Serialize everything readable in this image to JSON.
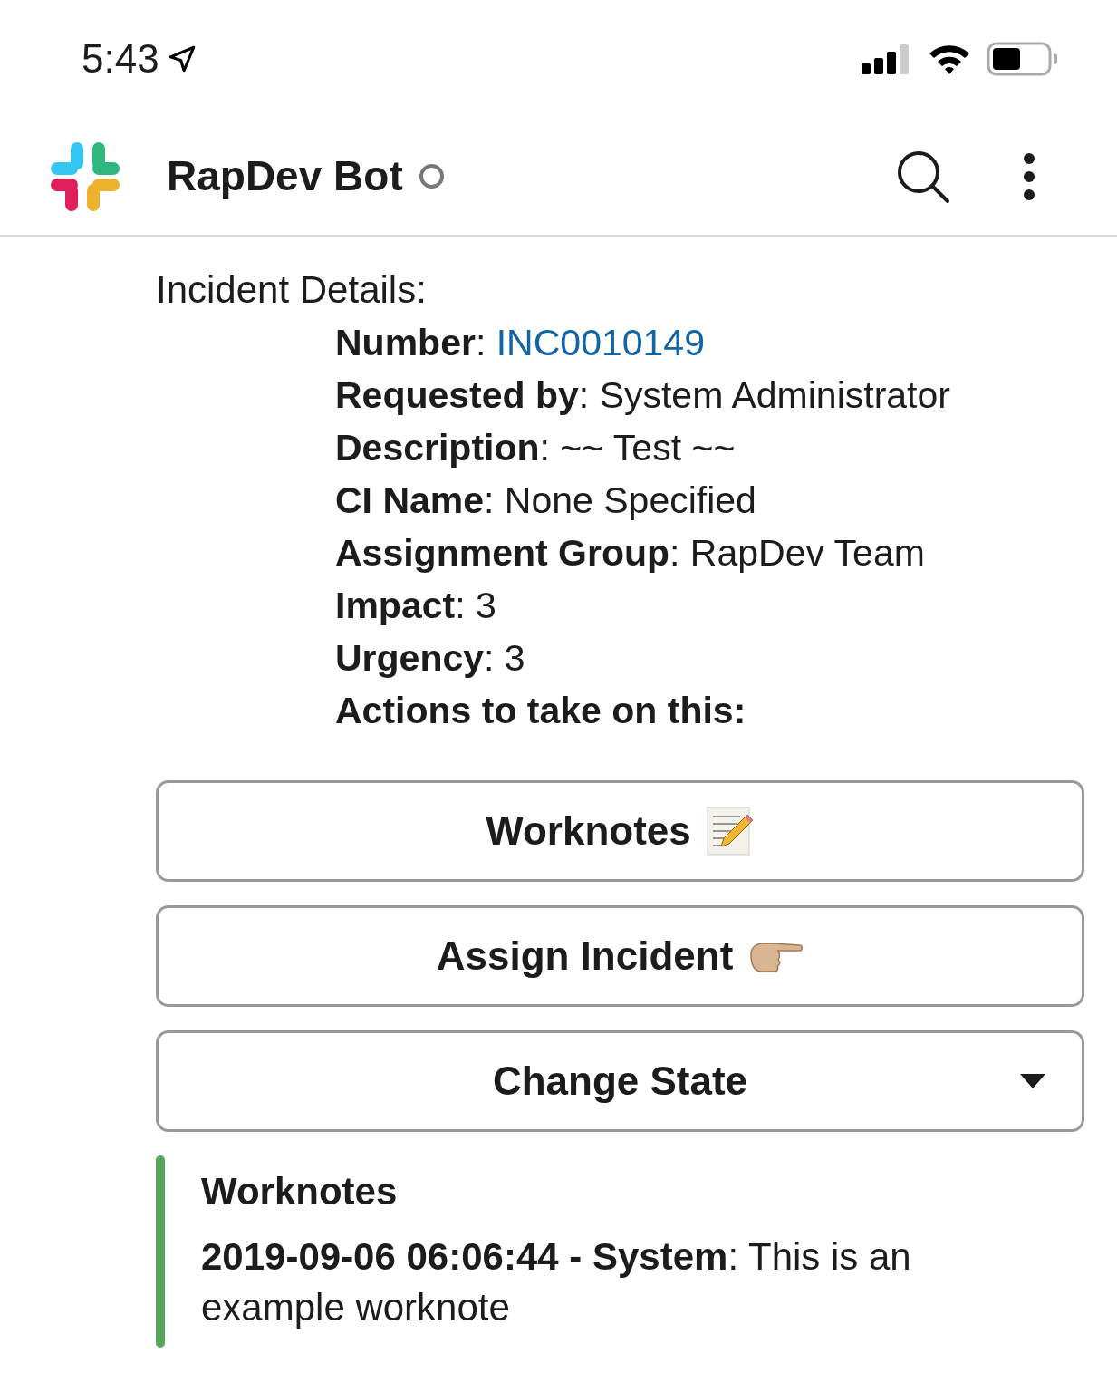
{
  "status_bar": {
    "time": "5:43"
  },
  "header": {
    "title": "RapDev Bot",
    "online": false
  },
  "message": {
    "intro": "Incident Details:",
    "fields": [
      {
        "kind": "link",
        "text": "**Number**: ",
        "link": "INC0010149"
      },
      {
        "kind": "text",
        "text": "**Requested by**: System Administrator"
      },
      {
        "kind": "text",
        "text": "**Description**: ~~ Test ~~"
      },
      {
        "kind": "text",
        "text": "**CI Name**: None Specified"
      },
      {
        "kind": "text",
        "text": "**Assignment Group**: RapDev Team"
      },
      {
        "kind": "text",
        "text": "**Impact**: 3"
      },
      {
        "kind": "text",
        "text": "**Urgency**: 3"
      }
    ],
    "actions_heading": "Actions to take on this:",
    "buttons": [
      {
        "kind": "memo",
        "label": "Worknotes"
      },
      {
        "kind": "point",
        "label": "Assign Incident"
      },
      {
        "kind": "select",
        "label": "Change State"
      }
    ],
    "attachment": {
      "title": "Worknotes",
      "text": "**2019-09-06 06:06:44 - System**: This is an example worknote"
    }
  }
}
